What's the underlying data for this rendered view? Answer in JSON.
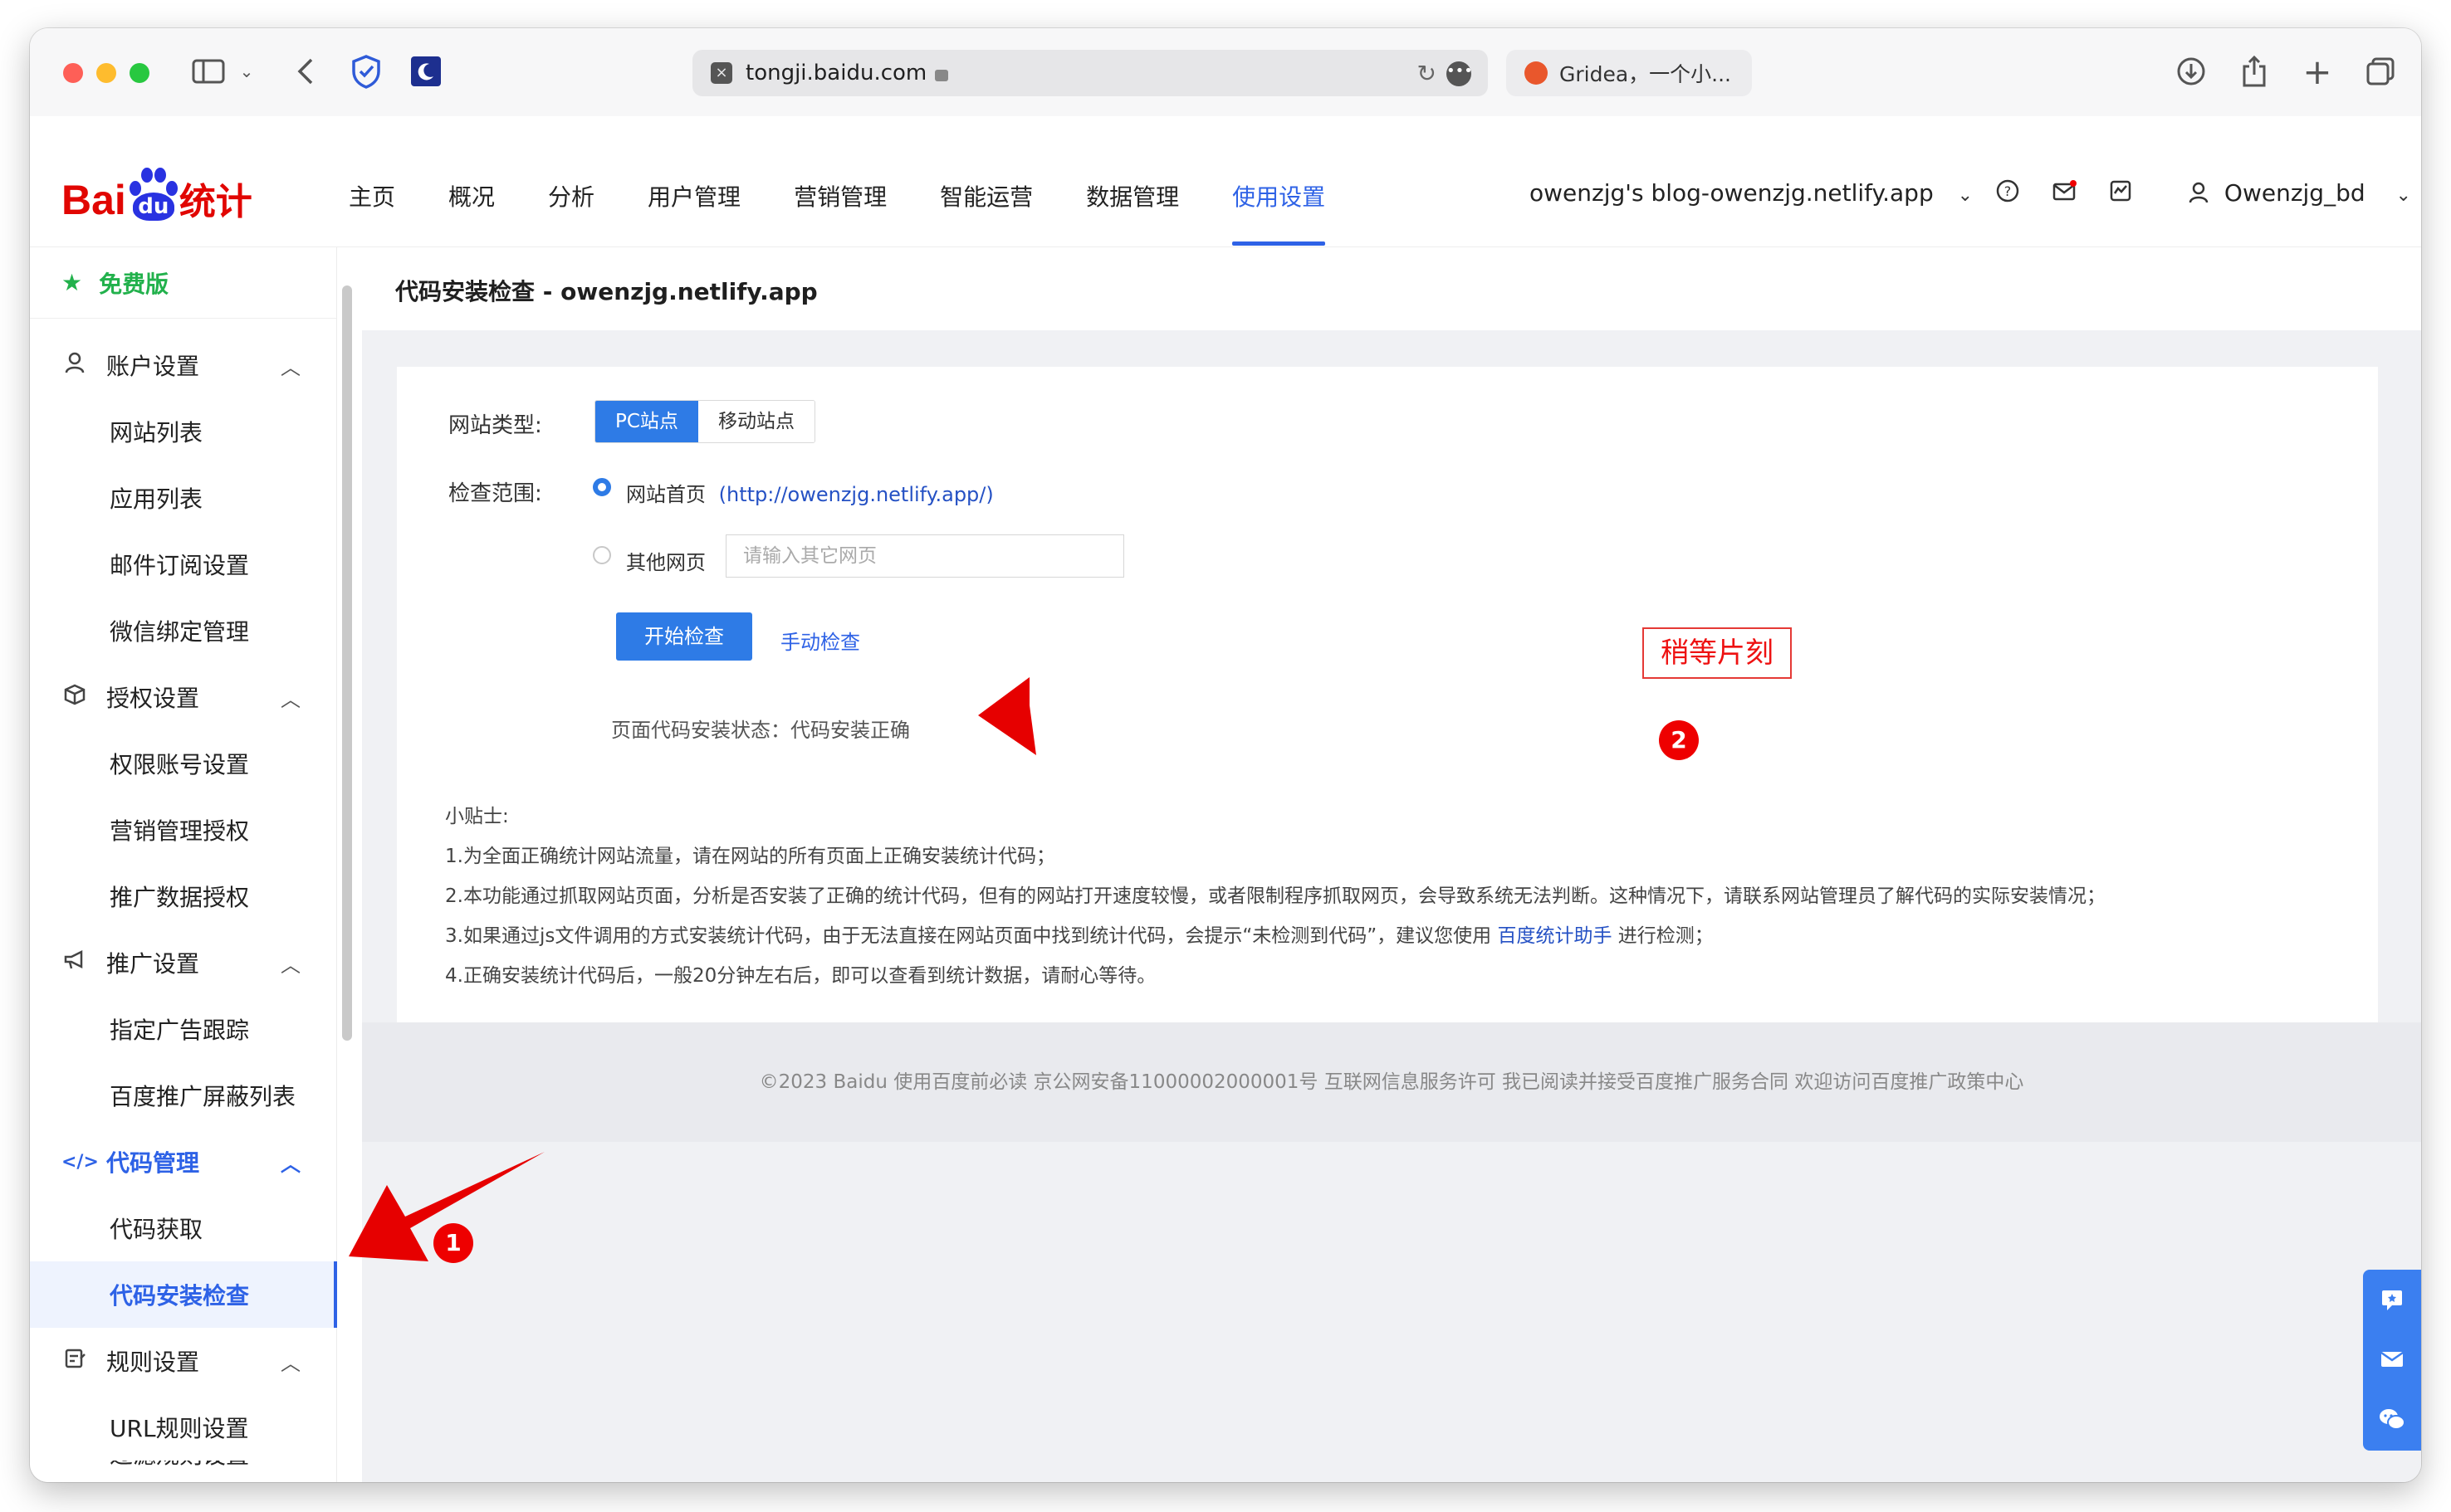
{
  "browser": {
    "address_url": "tongji.baidu.com",
    "second_tab_title": "Gridea，一个小..."
  },
  "brand": {
    "logo_text_left": "Bai",
    "logo_paw_text": "du",
    "logo_text_right": "统计"
  },
  "nav": {
    "items": [
      "主页",
      "概况",
      "分析",
      "用户管理",
      "营销管理",
      "智能运营",
      "数据管理",
      "使用设置"
    ],
    "active_index": 7
  },
  "header": {
    "site_selector": "owenzjg's blog-owenzjg.netlify.app",
    "username": "Owenzjg_bd"
  },
  "sidebar": {
    "edition": "免费版",
    "groups": [
      {
        "label": "账户设置",
        "icon": "user-icon",
        "items": [
          "网站列表",
          "应用列表",
          "邮件订阅设置",
          "微信绑定管理"
        ]
      },
      {
        "label": "授权设置",
        "icon": "cube-icon",
        "items": [
          "权限账号设置",
          "营销管理授权",
          "推广数据授权"
        ]
      },
      {
        "label": "推广设置",
        "icon": "megaphone-icon",
        "items": [
          "指定广告跟踪",
          "百度推广屏蔽列表"
        ]
      },
      {
        "label": "代码管理",
        "icon": "code-icon",
        "items": [
          "代码获取",
          "代码安装检查"
        ]
      },
      {
        "label": "规则设置",
        "icon": "rules-icon",
        "items": [
          "URL规则设置",
          "过滤规则设置"
        ]
      }
    ],
    "current_item": "代码安装检查"
  },
  "page": {
    "title": "代码安装检查 - owenzjg.netlify.app",
    "site_type_label": "网站类型:",
    "site_type_options": [
      "PC站点",
      "移动站点"
    ],
    "site_type_selected": "PC站点",
    "scope_label": "检查范围:",
    "scope_home_label": "网站首页",
    "scope_home_url": "(http://owenzjg.netlify.app/)",
    "scope_other_label": "其他网页",
    "scope_other_placeholder": "请输入其它网页",
    "start_button": "开始检查",
    "manual_check": "手动检查",
    "status_text": "页面代码安装状态：代码安装正确",
    "tips_title": "小贴士:",
    "tip1": "1.为全面正确统计网站流量，请在网站的所有页面上正确安装统计代码；",
    "tip2": "2.本功能通过抓取网站页面，分析是否安装了正确的统计代码，但有的网站打开速度较慢，或者限制程序抓取网页，会导致系统无法判断。这种情况下，请联系网站管理员了解代码的实际安装情况；",
    "tip3_before": "3.如果通过js文件调用的方式安装统计代码，由于无法直接在网站页面中找到统计代码，会提示“未检测到代码”，建议您使用",
    "tip3_link": "百度统计助手",
    "tip3_after": "进行检测；",
    "tip4": "4.正确安装统计代码后，一般20分钟左右后，即可以查看到统计数据，请耐心等待。"
  },
  "footer": {
    "text": "©2023 Baidu 使用百度前必读 京公网安备11000002000001号 互联网信息服务许可 我已阅读并接受百度推广服务合同 欢迎访问百度推广政策中心"
  },
  "annotations": {
    "wait_note": "稍等片刻",
    "badge1": "1",
    "badge2": "2",
    "arrow_color": "#e60000"
  },
  "colors": {
    "accent": "#2e62e6",
    "primary_button": "#2e7be6",
    "brand_red": "#e10602",
    "brand_blue": "#2932e1",
    "free_green": "#22b14c"
  }
}
